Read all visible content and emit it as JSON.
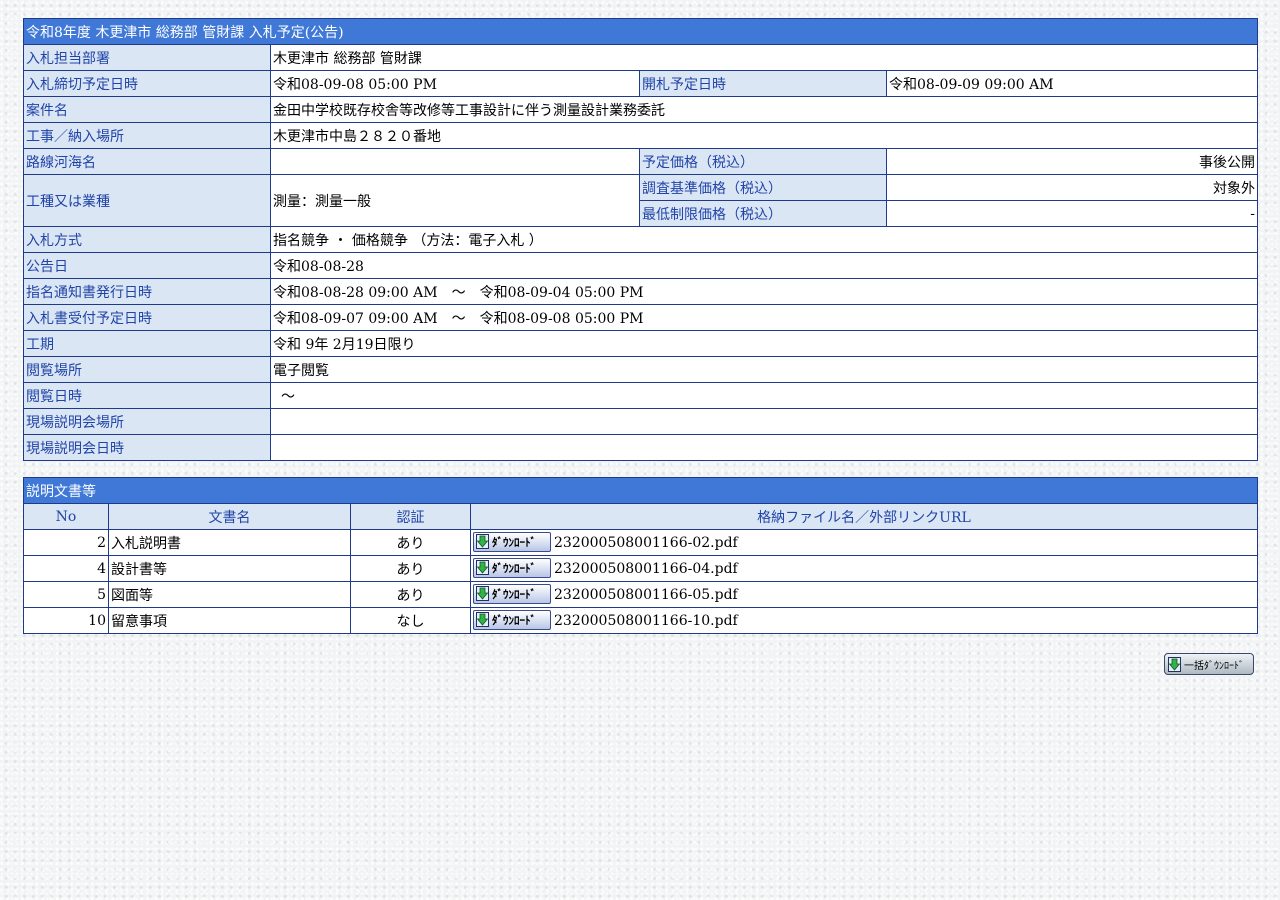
{
  "announcement": {
    "title": "令和8年度 木更津市 総務部 管財課 入札予定(公告)",
    "labels": {
      "dept": "入札担当部署",
      "deadline": "入札締切予定日時",
      "opening": "開札予定日時",
      "project": "案件名",
      "location": "工事／納入場所",
      "route": "路線河海名",
      "planned_price": "予定価格（税込）",
      "category": "工種又は業種",
      "survey_price": "調査基準価格（税込）",
      "min_price": "最低制限価格（税込）",
      "method": "入札方式",
      "notice_date": "公告日",
      "designation": "指名通知書発行日時",
      "receipt": "入札書受付予定日時",
      "period": "工期",
      "viewing_place": "閲覧場所",
      "viewing_time": "閲覧日時",
      "briefing_place": "現場説明会場所",
      "briefing_time": "現場説明会日時"
    },
    "values": {
      "dept": "木更津市 総務部 管財課",
      "deadline": "令和08-09-08 05:00 PM",
      "opening": "令和08-09-09 09:00 AM",
      "project": "金田中学校既存校舎等改修等工事設計に伴う測量設計業務委託",
      "location": "木更津市中島２８２０番地",
      "route": "",
      "planned_price": "事後公開",
      "category": "測量：測量一般",
      "survey_price": "対象外",
      "min_price": "-",
      "method": "指名競争 ・ 価格競争 （方法：電子入札 ）",
      "notice_date": "令和08-08-28",
      "designation": "令和08-08-28 09:00 AM　～　令和08-09-04 05:00 PM",
      "receipt": "令和08-09-07 09:00 AM　～　令和08-09-08 05:00 PM",
      "period": "令和 9年 2月19日限り",
      "viewing_place": "電子閲覧",
      "viewing_time": "～",
      "briefing_place": "",
      "briefing_time": ""
    }
  },
  "documents": {
    "title": "説明文書等",
    "headers": {
      "no": "No",
      "name": "文書名",
      "auth": "認証",
      "file": "格納ファイル名／外部リンクURL"
    },
    "download_label": "ﾀﾞｳﾝﾛｰﾄﾞ",
    "rows": [
      {
        "no": "2",
        "name": "入札説明書",
        "auth": "あり",
        "file": "232000508001166-02.pdf"
      },
      {
        "no": "4",
        "name": "設計書等",
        "auth": "あり",
        "file": "232000508001166-04.pdf"
      },
      {
        "no": "5",
        "name": "図面等",
        "auth": "あり",
        "file": "232000508001166-05.pdf"
      },
      {
        "no": "10",
        "name": "留意事項",
        "auth": "なし",
        "file": "232000508001166-10.pdf"
      }
    ],
    "bulk_download_label": "一括ﾀﾞｳﾝﾛｰﾄﾞ"
  },
  "icons": {
    "download": "download-arrow-icon"
  },
  "colors": {
    "header_bg": "#3f78d6",
    "label_bg": "#dbe6f5",
    "label_text": "#2044a8",
    "border": "#1f3a8a"
  }
}
